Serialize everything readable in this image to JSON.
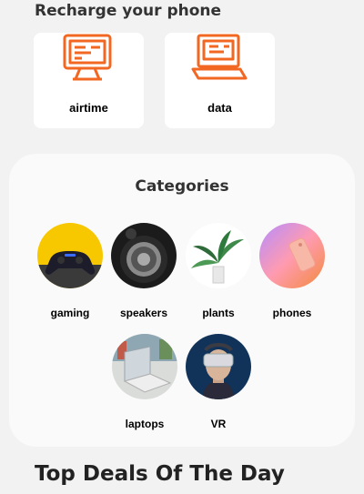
{
  "recharge": {
    "title": "Recharge your phone",
    "accent": "#f26722",
    "cards": [
      {
        "label": "airtime",
        "icon": "computer-screen-icon"
      },
      {
        "label": "data",
        "icon": "laptop-icon"
      }
    ]
  },
  "categories": {
    "title": "Categories",
    "items": [
      {
        "label": "gaming",
        "image": "game-controller"
      },
      {
        "label": "speakers",
        "image": "speaker"
      },
      {
        "label": "plants",
        "image": "potted-plant"
      },
      {
        "label": "phones",
        "image": "smartphone"
      },
      {
        "label": "laptops",
        "image": "laptop"
      },
      {
        "label": "VR",
        "image": "vr-headset"
      }
    ]
  },
  "deals": {
    "title": "Top Deals Of The Day"
  }
}
